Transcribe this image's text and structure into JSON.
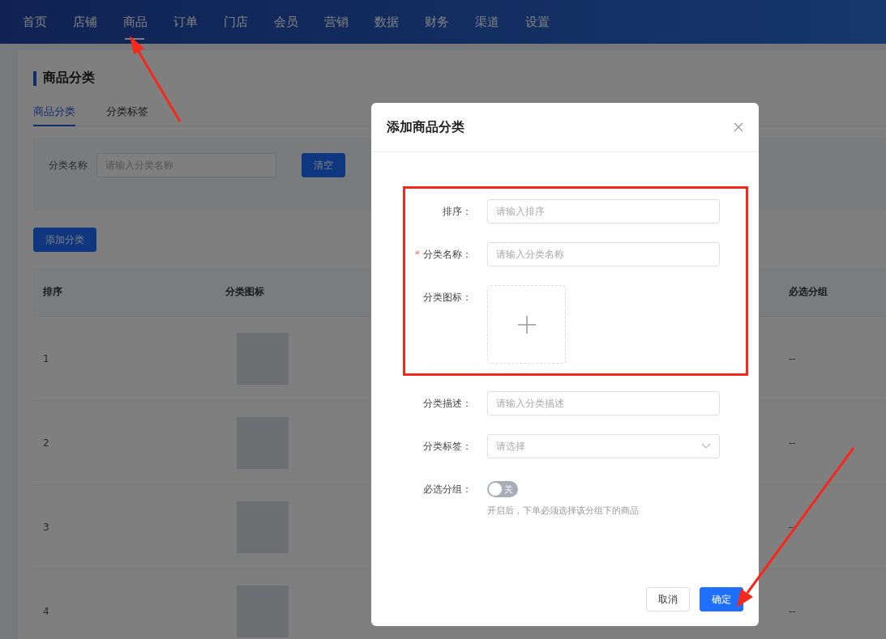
{
  "nav": {
    "items": [
      {
        "label": "首页",
        "selected": false
      },
      {
        "label": "店铺",
        "selected": false
      },
      {
        "label": "商品",
        "selected": true
      },
      {
        "label": "订单",
        "selected": false
      },
      {
        "label": "门店",
        "selected": false
      },
      {
        "label": "会员",
        "selected": false
      },
      {
        "label": "营销",
        "selected": false
      },
      {
        "label": "数据",
        "selected": false
      },
      {
        "label": "财务",
        "selected": false
      },
      {
        "label": "渠道",
        "selected": false
      },
      {
        "label": "设置",
        "selected": false
      }
    ]
  },
  "page": {
    "title": "商品分类",
    "tabs": [
      {
        "label": "商品分类",
        "selected": true
      },
      {
        "label": "分类标签",
        "selected": false
      }
    ],
    "filter": {
      "label": "分类名称",
      "placeholder": "请输入分类名称",
      "button": "清空"
    },
    "add_button": "添加分类",
    "table": {
      "columns": [
        "排序",
        "分类图标",
        "必选分组"
      ],
      "rows": [
        {
          "order": "1",
          "required_group": "--"
        },
        {
          "order": "2",
          "required_group": "--"
        },
        {
          "order": "3",
          "required_group": "--"
        },
        {
          "order": "4",
          "required_group": "--"
        }
      ]
    }
  },
  "dialog": {
    "title": "添加商品分类",
    "sections": [
      {
        "highlighted": true,
        "fields": [
          {
            "kind": "input",
            "label": "排序：",
            "placeholder": "请输入排序"
          },
          {
            "kind": "input",
            "label": "分类名称：",
            "required_mark": "*",
            "placeholder": "请输入分类名称"
          },
          {
            "kind": "upload",
            "label": "分类图标："
          }
        ]
      },
      {
        "highlighted": false,
        "fields": [
          {
            "kind": "input",
            "label": "分类描述：",
            "placeholder": "请输入分类描述"
          },
          {
            "kind": "select",
            "label": "分类标签：",
            "placeholder": "请选择"
          },
          {
            "kind": "switch",
            "label": "必选分组：",
            "on": false,
            "switch_text": "关",
            "hint": "开启后，下单必须选择该分组下的商品"
          }
        ]
      }
    ],
    "buttons": [
      {
        "label": "取消",
        "kind": "default"
      },
      {
        "label": "确定",
        "kind": "primary"
      }
    ]
  }
}
